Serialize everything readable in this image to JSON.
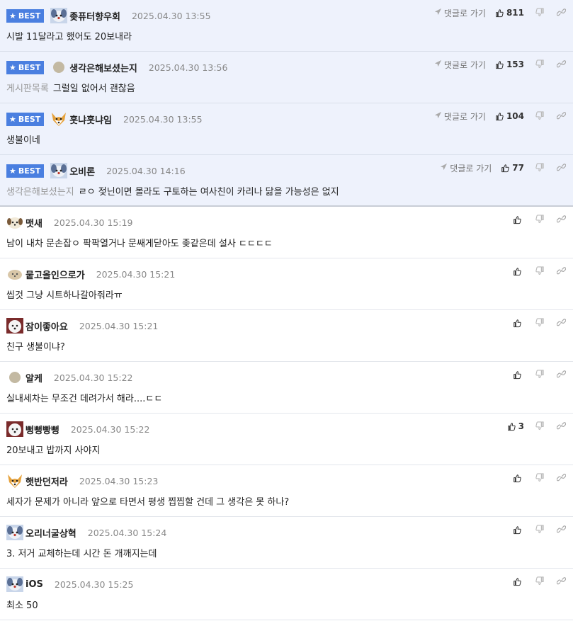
{
  "ui": {
    "best_label": "BEST",
    "reply_label": "댓글로 가기"
  },
  "comments": [
    {
      "best": true,
      "avatar": "blue-dog-avatar",
      "nick": "좆퓨터향우회",
      "date": "2025.04.30 13:55",
      "text": "시발 11달라고 했어도 20보내라",
      "likes": "811"
    },
    {
      "best": true,
      "avatar": "gray-dot-avatar",
      "nick": "생각은해보셨는지",
      "date": "2025.04.30 13:56",
      "prefix": "게시판목록",
      "text": "그럴일 없어서 괜찮음",
      "likes": "153"
    },
    {
      "best": true,
      "avatar": "fox-avatar",
      "nick": "훗냐훗냐임",
      "date": "2025.04.30 13:55",
      "text": "생불이네",
      "likes": "104"
    },
    {
      "best": true,
      "avatar": "blue-dog-avatar",
      "nick": "오비론",
      "date": "2025.04.30 14:16",
      "prefix": "생각은해보셨는지",
      "text": "ㄹㅇ 젖닌이면 몰라도 구토하는 여사친이 카리나 닮을 가능성은 없지",
      "likes": "77"
    },
    {
      "best": false,
      "avatar": "puppy-avatar",
      "nick": "맷새",
      "date": "2025.04.30 15:19",
      "text": "남이 내차 문손잡ㅇ 팍팍열거나 문쌔게닫아도 좆같은데 설사 ㄷㄷㄷㄷ",
      "likes": ""
    },
    {
      "best": false,
      "avatar": "beige-dog-avatar",
      "nick": "뭍고올인으로가",
      "date": "2025.04.30 15:21",
      "text": "씹것 그냥 시트하나갈아줘라ㅠ",
      "likes": ""
    },
    {
      "best": false,
      "avatar": "maltese-avatar",
      "nick": "잠이좋아요",
      "date": "2025.04.30 15:21",
      "text": "친구 생불이냐?",
      "likes": ""
    },
    {
      "best": false,
      "avatar": "gray-dot-avatar",
      "nick": "알케",
      "date": "2025.04.30 15:22",
      "text": "실내세차는 무조건 데려가서 해라....ㄷㄷ",
      "likes": ""
    },
    {
      "best": false,
      "avatar": "maltese-avatar",
      "nick": "뻥뻥빵뻥",
      "date": "2025.04.30 15:22",
      "text": "20보내고 밥까지 사야지",
      "likes": "3"
    },
    {
      "best": false,
      "avatar": "fox-avatar",
      "nick": "햇반던저라",
      "date": "2025.04.30 15:23",
      "text": "세자가 문제가 아니라 앞으로 타면서 평생 찝찝할 건데 그 생각은 못 하나?",
      "likes": ""
    },
    {
      "best": false,
      "avatar": "blue-dog-avatar",
      "nick": "오리너굴상혁",
      "date": "2025.04.30 15:24",
      "text": "3. 저거 교체하는데 시간 돈 개깨지는데",
      "likes": ""
    },
    {
      "best": false,
      "avatar": "blue-dog-avatar",
      "nick": "iOS",
      "date": "2025.04.30 15:25",
      "text": "최소 50",
      "likes": ""
    }
  ]
}
